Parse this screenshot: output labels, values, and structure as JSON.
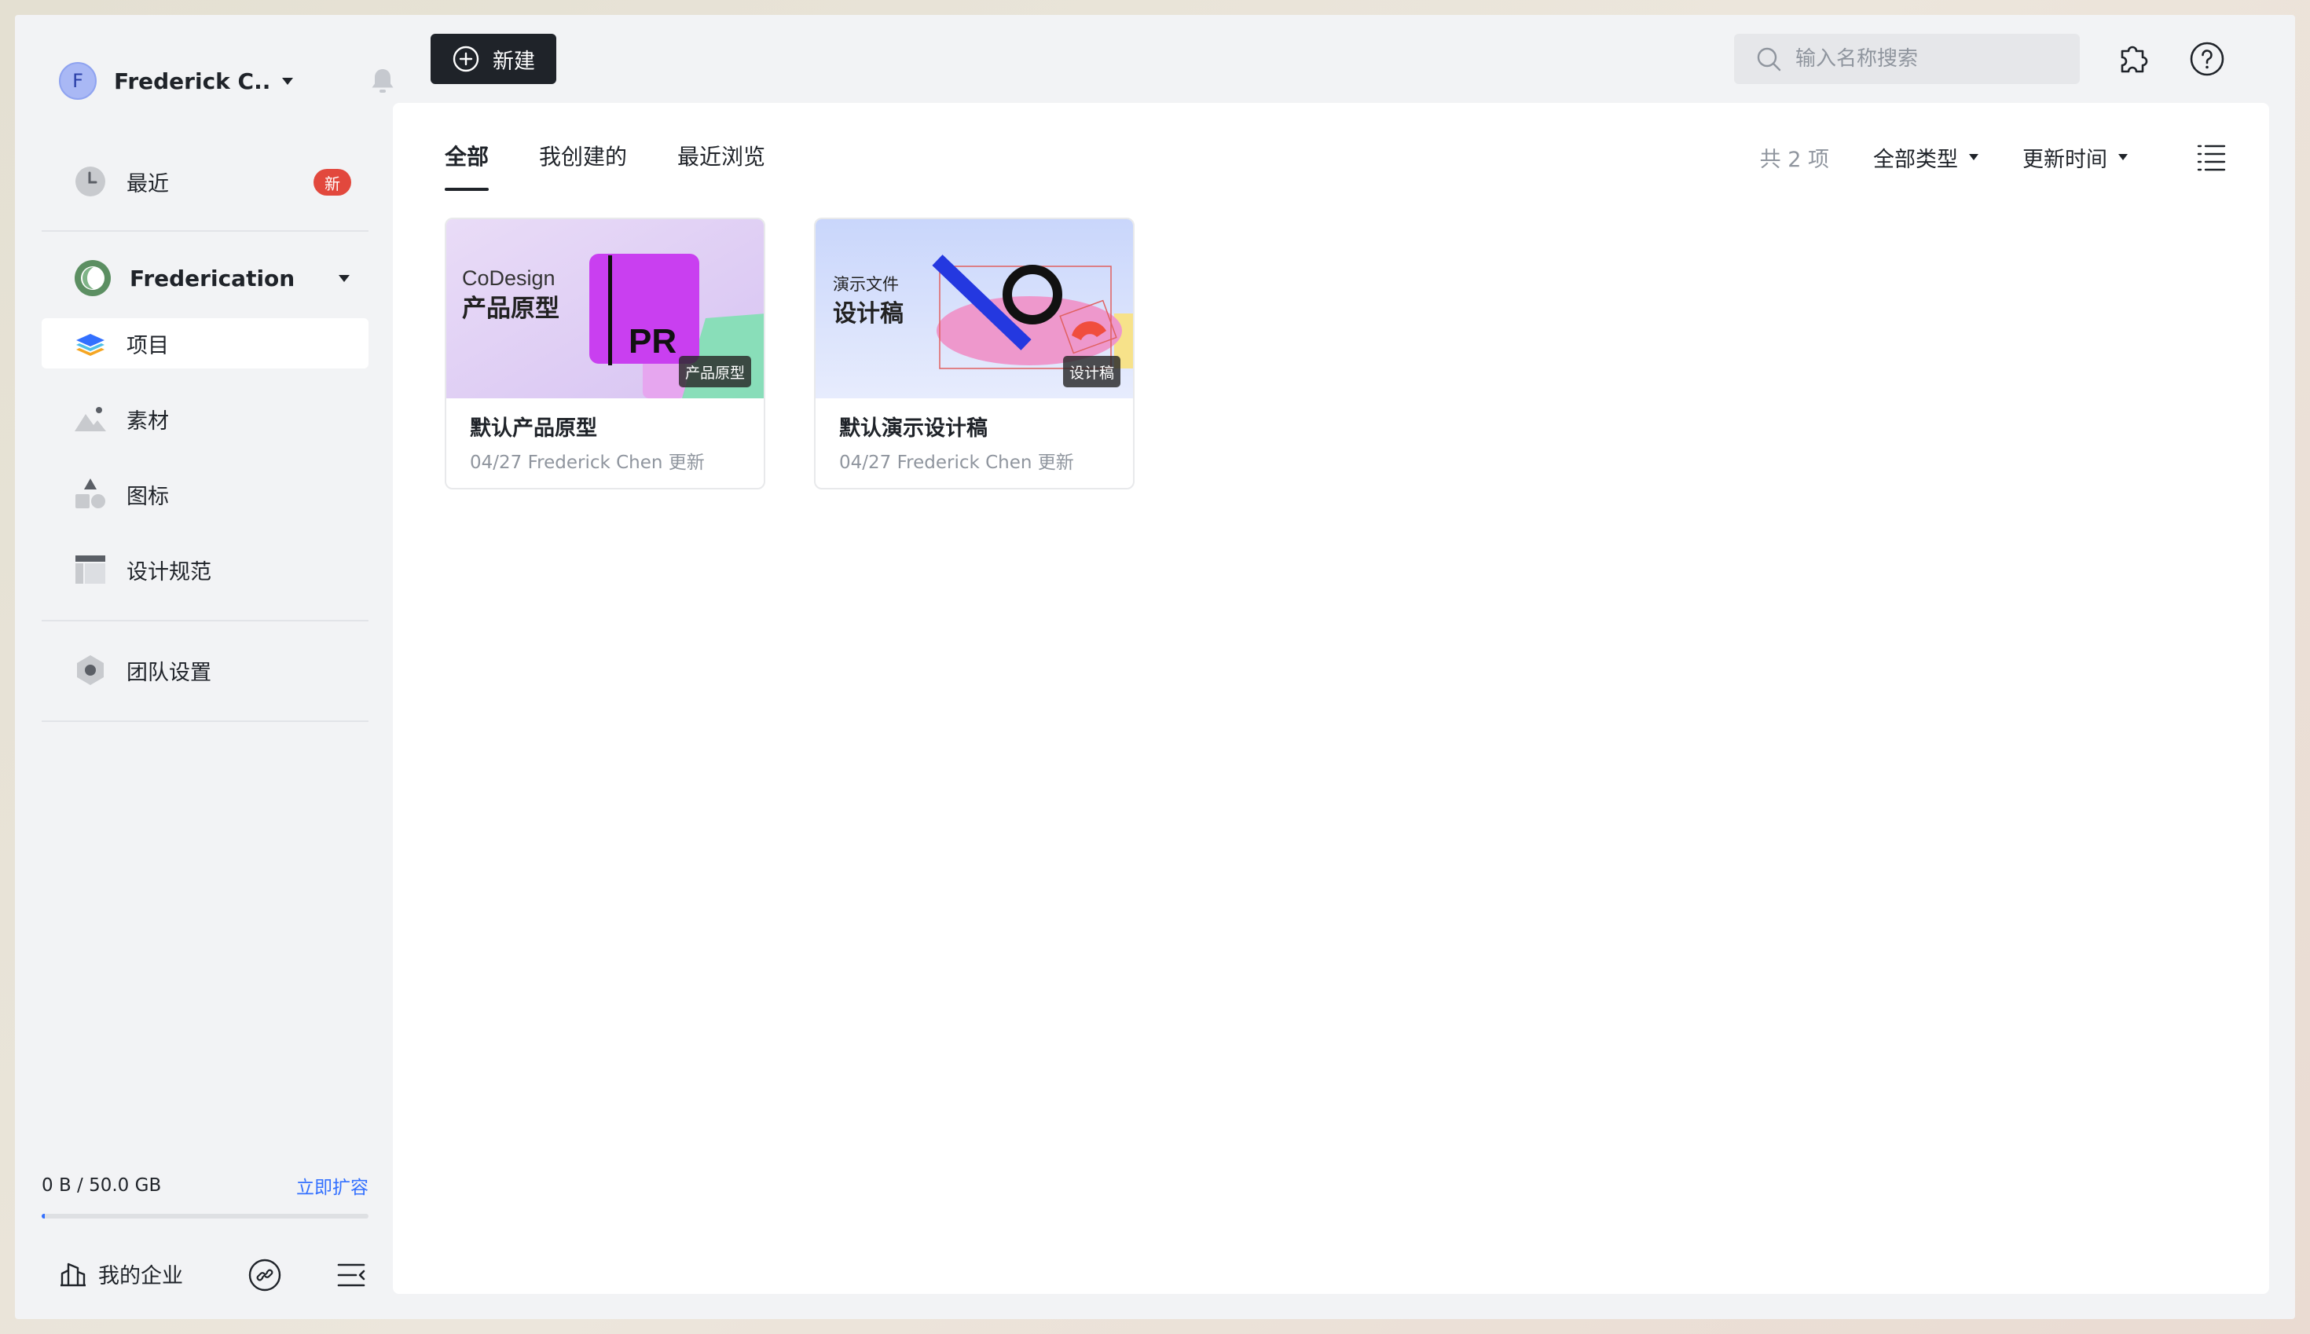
{
  "user": {
    "initial": "F",
    "name": "Frederick C..."
  },
  "sidebar": {
    "recent": {
      "label": "最近",
      "badge": "新"
    },
    "team": {
      "name": "Frederication"
    },
    "items": [
      {
        "label": "项目",
        "icon": "layers-icon",
        "active": true
      },
      {
        "label": "素材",
        "icon": "mountain-image-icon"
      },
      {
        "label": "图标",
        "icon": "shapes-icon"
      },
      {
        "label": "设计规范",
        "icon": "layout-grid-icon"
      }
    ],
    "settings": {
      "label": "团队设置",
      "icon": "hexagon-gear-icon"
    },
    "storage": {
      "used": "0 B",
      "separator": "/",
      "total": "50.0 GB",
      "upgrade_label": "立即扩容",
      "used_fraction": 0.01
    },
    "enterprise_label": "我的企业"
  },
  "topbar": {
    "new_label": "新建",
    "search_placeholder": "输入名称搜索"
  },
  "main": {
    "tabs": [
      {
        "label": "全部",
        "active": true
      },
      {
        "label": "我创建的"
      },
      {
        "label": "最近浏览"
      }
    ],
    "count_text": "共 2 项",
    "type_filter": "全部类型",
    "sort_filter": "更新时间"
  },
  "cards": [
    {
      "title": "默认产品原型",
      "meta": "04/27 Frederick Chen 更新",
      "tag": "产品原型",
      "thumb_line1": "CoDesign",
      "thumb_line2": "产品原型",
      "thumb_logo": "PR"
    },
    {
      "title": "默认演示设计稿",
      "meta": "04/27 Frederick Chen 更新",
      "tag": "设计稿",
      "thumb_line1": "演示文件",
      "thumb_line2": "设计稿"
    }
  ],
  "colors": {
    "accent": "#3370ff",
    "badge": "#e2483d",
    "dark_button": "#1f2329"
  }
}
